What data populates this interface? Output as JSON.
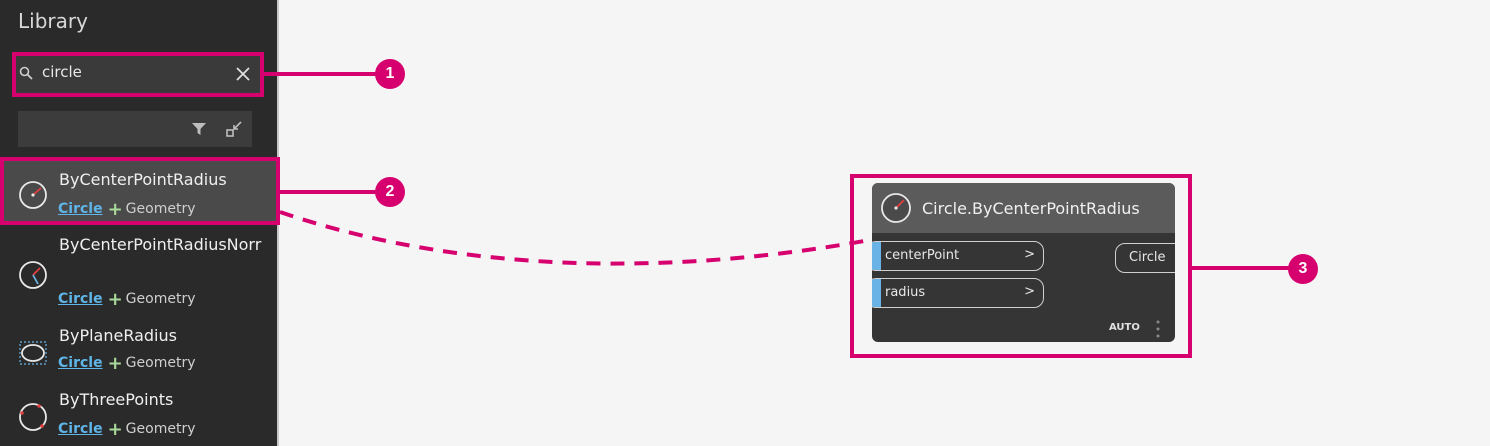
{
  "library": {
    "title": "Library",
    "search": {
      "value": "circle"
    },
    "items": [
      {
        "name": "ByCenterPointRadius",
        "category": "Circle",
        "parent": "Geometry",
        "selected": true
      },
      {
        "name": "ByCenterPointRadiusNorr",
        "category": "Circle",
        "parent": "Geometry",
        "selected": false
      },
      {
        "name": "ByPlaneRadius",
        "category": "Circle",
        "parent": "Geometry",
        "selected": false
      },
      {
        "name": "ByThreePoints",
        "category": "Circle",
        "parent": "Geometry",
        "selected": false
      }
    ]
  },
  "node": {
    "title": "Circle.ByCenterPointRadius",
    "inputs": [
      {
        "label": "centerPoint",
        "arrow": ">"
      },
      {
        "label": "radius",
        "arrow": ">"
      }
    ],
    "output": "Circle",
    "lacing": "AUTO"
  },
  "callouts": [
    "1",
    "2",
    "3"
  ],
  "colors": {
    "highlight": "#d6006f",
    "sidebar_bg": "#2a2a2a",
    "port_accent": "#6ab3e6",
    "category_link": "#5fb4e8"
  }
}
